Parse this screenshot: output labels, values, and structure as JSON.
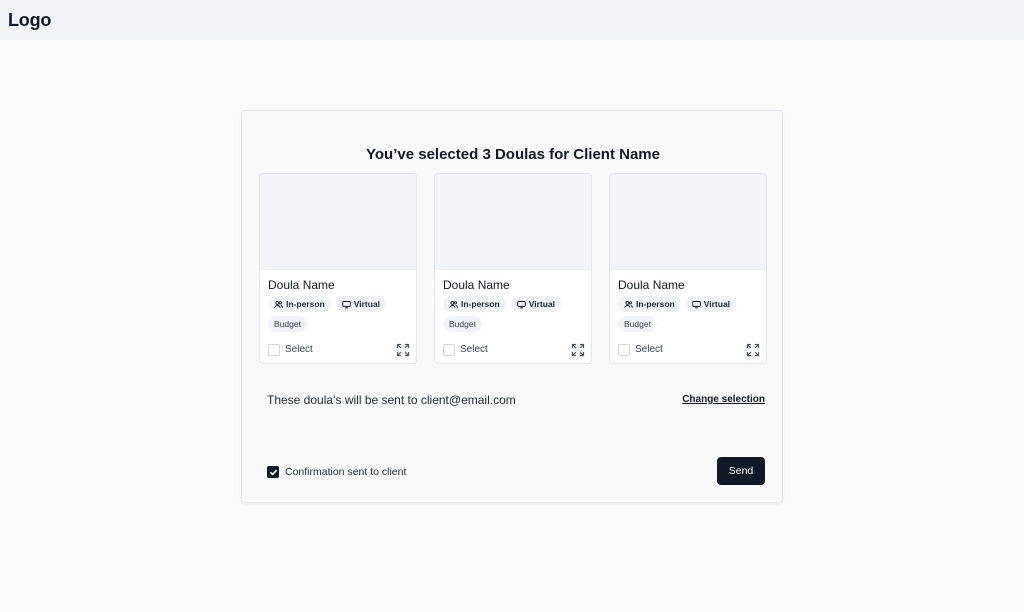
{
  "header": {
    "logo": "Logo"
  },
  "panel": {
    "heading": "You’ve selected 3 Doulas for Client Name",
    "cards": [
      {
        "name": "Doula Name",
        "tags": [
          "In-person",
          "Virtual",
          "Budget"
        ],
        "select_label": "Select"
      },
      {
        "name": "Doula Name",
        "tags": [
          "In-person",
          "Virtual",
          "Budget"
        ],
        "select_label": "Select"
      },
      {
        "name": "Doula Name",
        "tags": [
          "In-person",
          "Virtual",
          "Budget"
        ],
        "select_label": "Select"
      }
    ],
    "recipient_text": "These doula’s will be sent to client@email.com",
    "change_selection": "Change selection",
    "confirmation_label": "Confirmation sent to client",
    "confirmation_checked": true,
    "send_label": "Send"
  },
  "icons": [
    "users-icon",
    "monitor-icon",
    "expand-icon",
    "check-icon"
  ],
  "colors": {
    "primary": "#111827",
    "topbar": "#f1f4f8",
    "background": "#fafafa"
  }
}
